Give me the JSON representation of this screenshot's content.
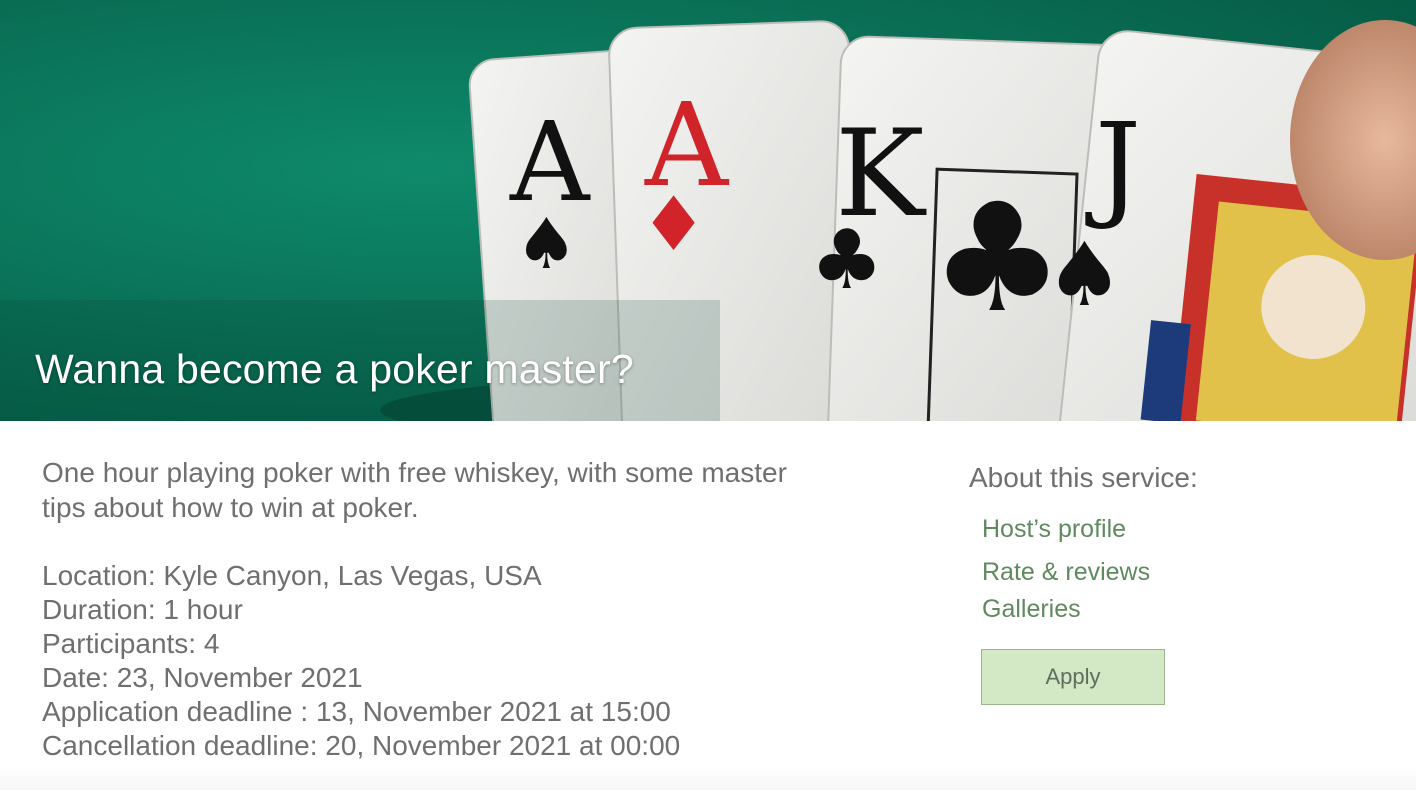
{
  "hero": {
    "title": "Wanna become a poker master?",
    "cards": [
      {
        "rank": "A",
        "suit": "♠",
        "color": "#111111"
      },
      {
        "rank": "A",
        "suit": "♦",
        "color": "#d0242a"
      },
      {
        "rank": "K",
        "suit": "♣",
        "color": "#111111"
      },
      {
        "rank": "J",
        "suit": "♠",
        "color": "#111111"
      }
    ]
  },
  "description": "One hour playing poker with free whiskey, with some master tips about how to win at poker.",
  "details": [
    "Location: Kyle Canyon, Las Vegas, USA",
    "Duration: 1 hour",
    "Participants: 4",
    "Date: 23, November 2021",
    "Application deadline : 13, November 2021 at 15:00",
    "Cancellation deadline: 20, November 2021 at 00:00"
  ],
  "aside": {
    "heading": "About this service:",
    "links": {
      "host_profile": "Host’s profile",
      "rate_reviews": "Rate & reviews",
      "galleries": "Galleries"
    },
    "apply_label": "Apply"
  },
  "colors": {
    "felt": "#0a7258",
    "link": "#5e8a5e",
    "button_bg": "#d3e8c5",
    "text": "#6f6f6f"
  }
}
